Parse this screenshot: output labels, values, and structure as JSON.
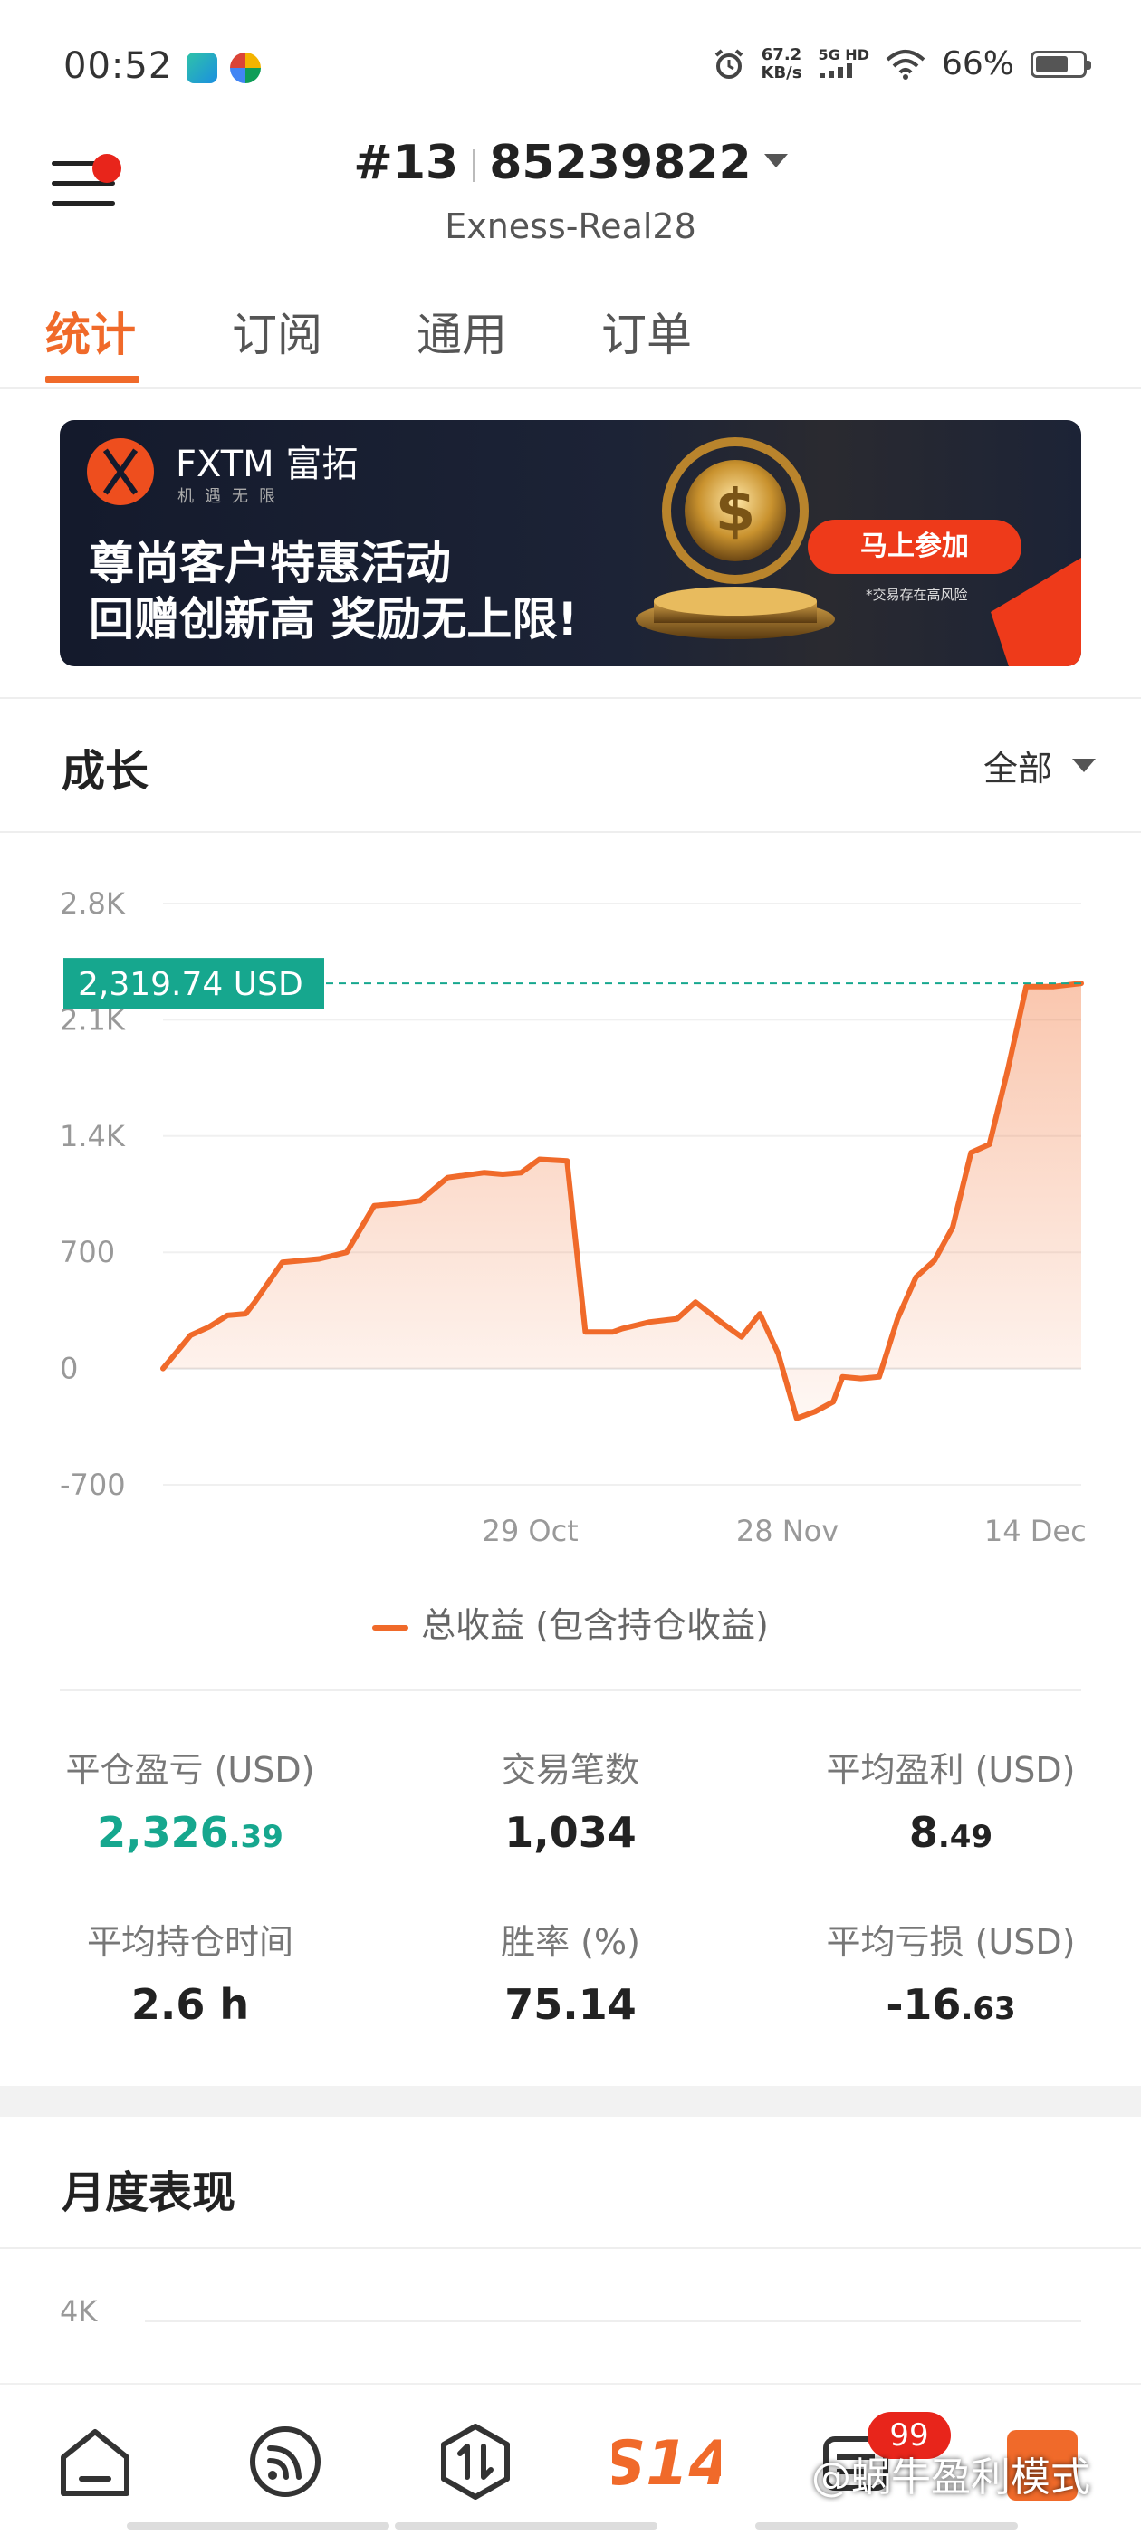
{
  "status_bar": {
    "time": "00:52",
    "speed_value": "67.2",
    "speed_unit": "KB/s",
    "network": "5G HD",
    "battery": "66%"
  },
  "header": {
    "account_prefix": "#13",
    "account_number": "85239822",
    "server": "Exness-Real28"
  },
  "tabs": [
    {
      "label": "统计",
      "active": true
    },
    {
      "label": "订阅",
      "active": false
    },
    {
      "label": "通用",
      "active": false
    },
    {
      "label": "订单",
      "active": false
    }
  ],
  "banner": {
    "brand": "FXTM 富拓",
    "slogan": "机遇无限",
    "line1": "尊尚客户特惠活动",
    "line2": "回赠创新高 奖励无上限!",
    "button": "马上参加",
    "note": "*交易存在高风险"
  },
  "growth": {
    "title": "成长",
    "range": "全部"
  },
  "chart_data": {
    "type": "area",
    "title": "",
    "current_value_label": "2,319.74 USD",
    "current_value": 2319.74,
    "ylim": [
      -700,
      2800
    ],
    "y_ticks": [
      "2.8K",
      "2.1K",
      "1.4K",
      "700",
      "0",
      "-700"
    ],
    "y_tick_values": [
      2800,
      2100,
      1400,
      700,
      0,
      -700
    ],
    "x_ticks": [
      "29 Oct",
      "28 Nov",
      "14 Dec"
    ],
    "x_tick_positions": [
      0.4,
      0.68,
      0.95
    ],
    "legend": "总收益 (包含持仓收益)",
    "series_color": "#f06a2a",
    "grid": true,
    "series": [
      {
        "name": "总收益 (包含持仓收益)",
        "x": [
          0.0,
          0.03,
          0.05,
          0.07,
          0.09,
          0.1,
          0.13,
          0.15,
          0.17,
          0.2,
          0.23,
          0.25,
          0.28,
          0.31,
          0.35,
          0.37,
          0.39,
          0.41,
          0.44,
          0.46,
          0.47,
          0.49,
          0.5,
          0.53,
          0.56,
          0.58,
          0.61,
          0.63,
          0.65,
          0.67,
          0.69,
          0.71,
          0.73,
          0.74,
          0.76,
          0.78,
          0.8,
          0.82,
          0.84,
          0.86,
          0.88,
          0.9,
          0.92,
          0.94,
          0.95,
          0.97,
          1.0
        ],
        "values": [
          0,
          200,
          250,
          320,
          330,
          400,
          640,
          650,
          660,
          700,
          980,
          990,
          1010,
          1150,
          1180,
          1170,
          1180,
          1260,
          1250,
          220,
          220,
          220,
          240,
          280,
          300,
          400,
          270,
          190,
          330,
          90,
          -300,
          -260,
          -200,
          -50,
          -60,
          -50,
          300,
          550,
          650,
          850,
          1300,
          1350,
          1800,
          2300,
          2300,
          2300,
          2319.74
        ]
      }
    ]
  },
  "stats": [
    {
      "label": "平仓盈亏 (USD)",
      "main": "2,326",
      "decimal": ".39",
      "color": "green"
    },
    {
      "label": "交易笔数",
      "main": "1,034",
      "decimal": "",
      "color": "default"
    },
    {
      "label": "平均盈利 (USD)",
      "main": "8",
      "decimal": ".49",
      "color": "default"
    },
    {
      "label": "平均持仓时间",
      "main": "2.6 h",
      "decimal": "",
      "color": "default"
    },
    {
      "label": "胜率 (%)",
      "main": "75.14",
      "decimal": "",
      "color": "default"
    },
    {
      "label": "平均亏损 (USD)",
      "main": "-16",
      "decimal": ".63",
      "color": "default"
    }
  ],
  "monthly": {
    "title": "月度表现",
    "y_tick": "4K"
  },
  "bottom_nav": {
    "badge": "99",
    "items": [
      "home-icon",
      "feed-icon",
      "trade-icon",
      "s14-logo",
      "messages-icon",
      "profile-icon"
    ]
  },
  "watermark": "@蜗牛盈利模式"
}
